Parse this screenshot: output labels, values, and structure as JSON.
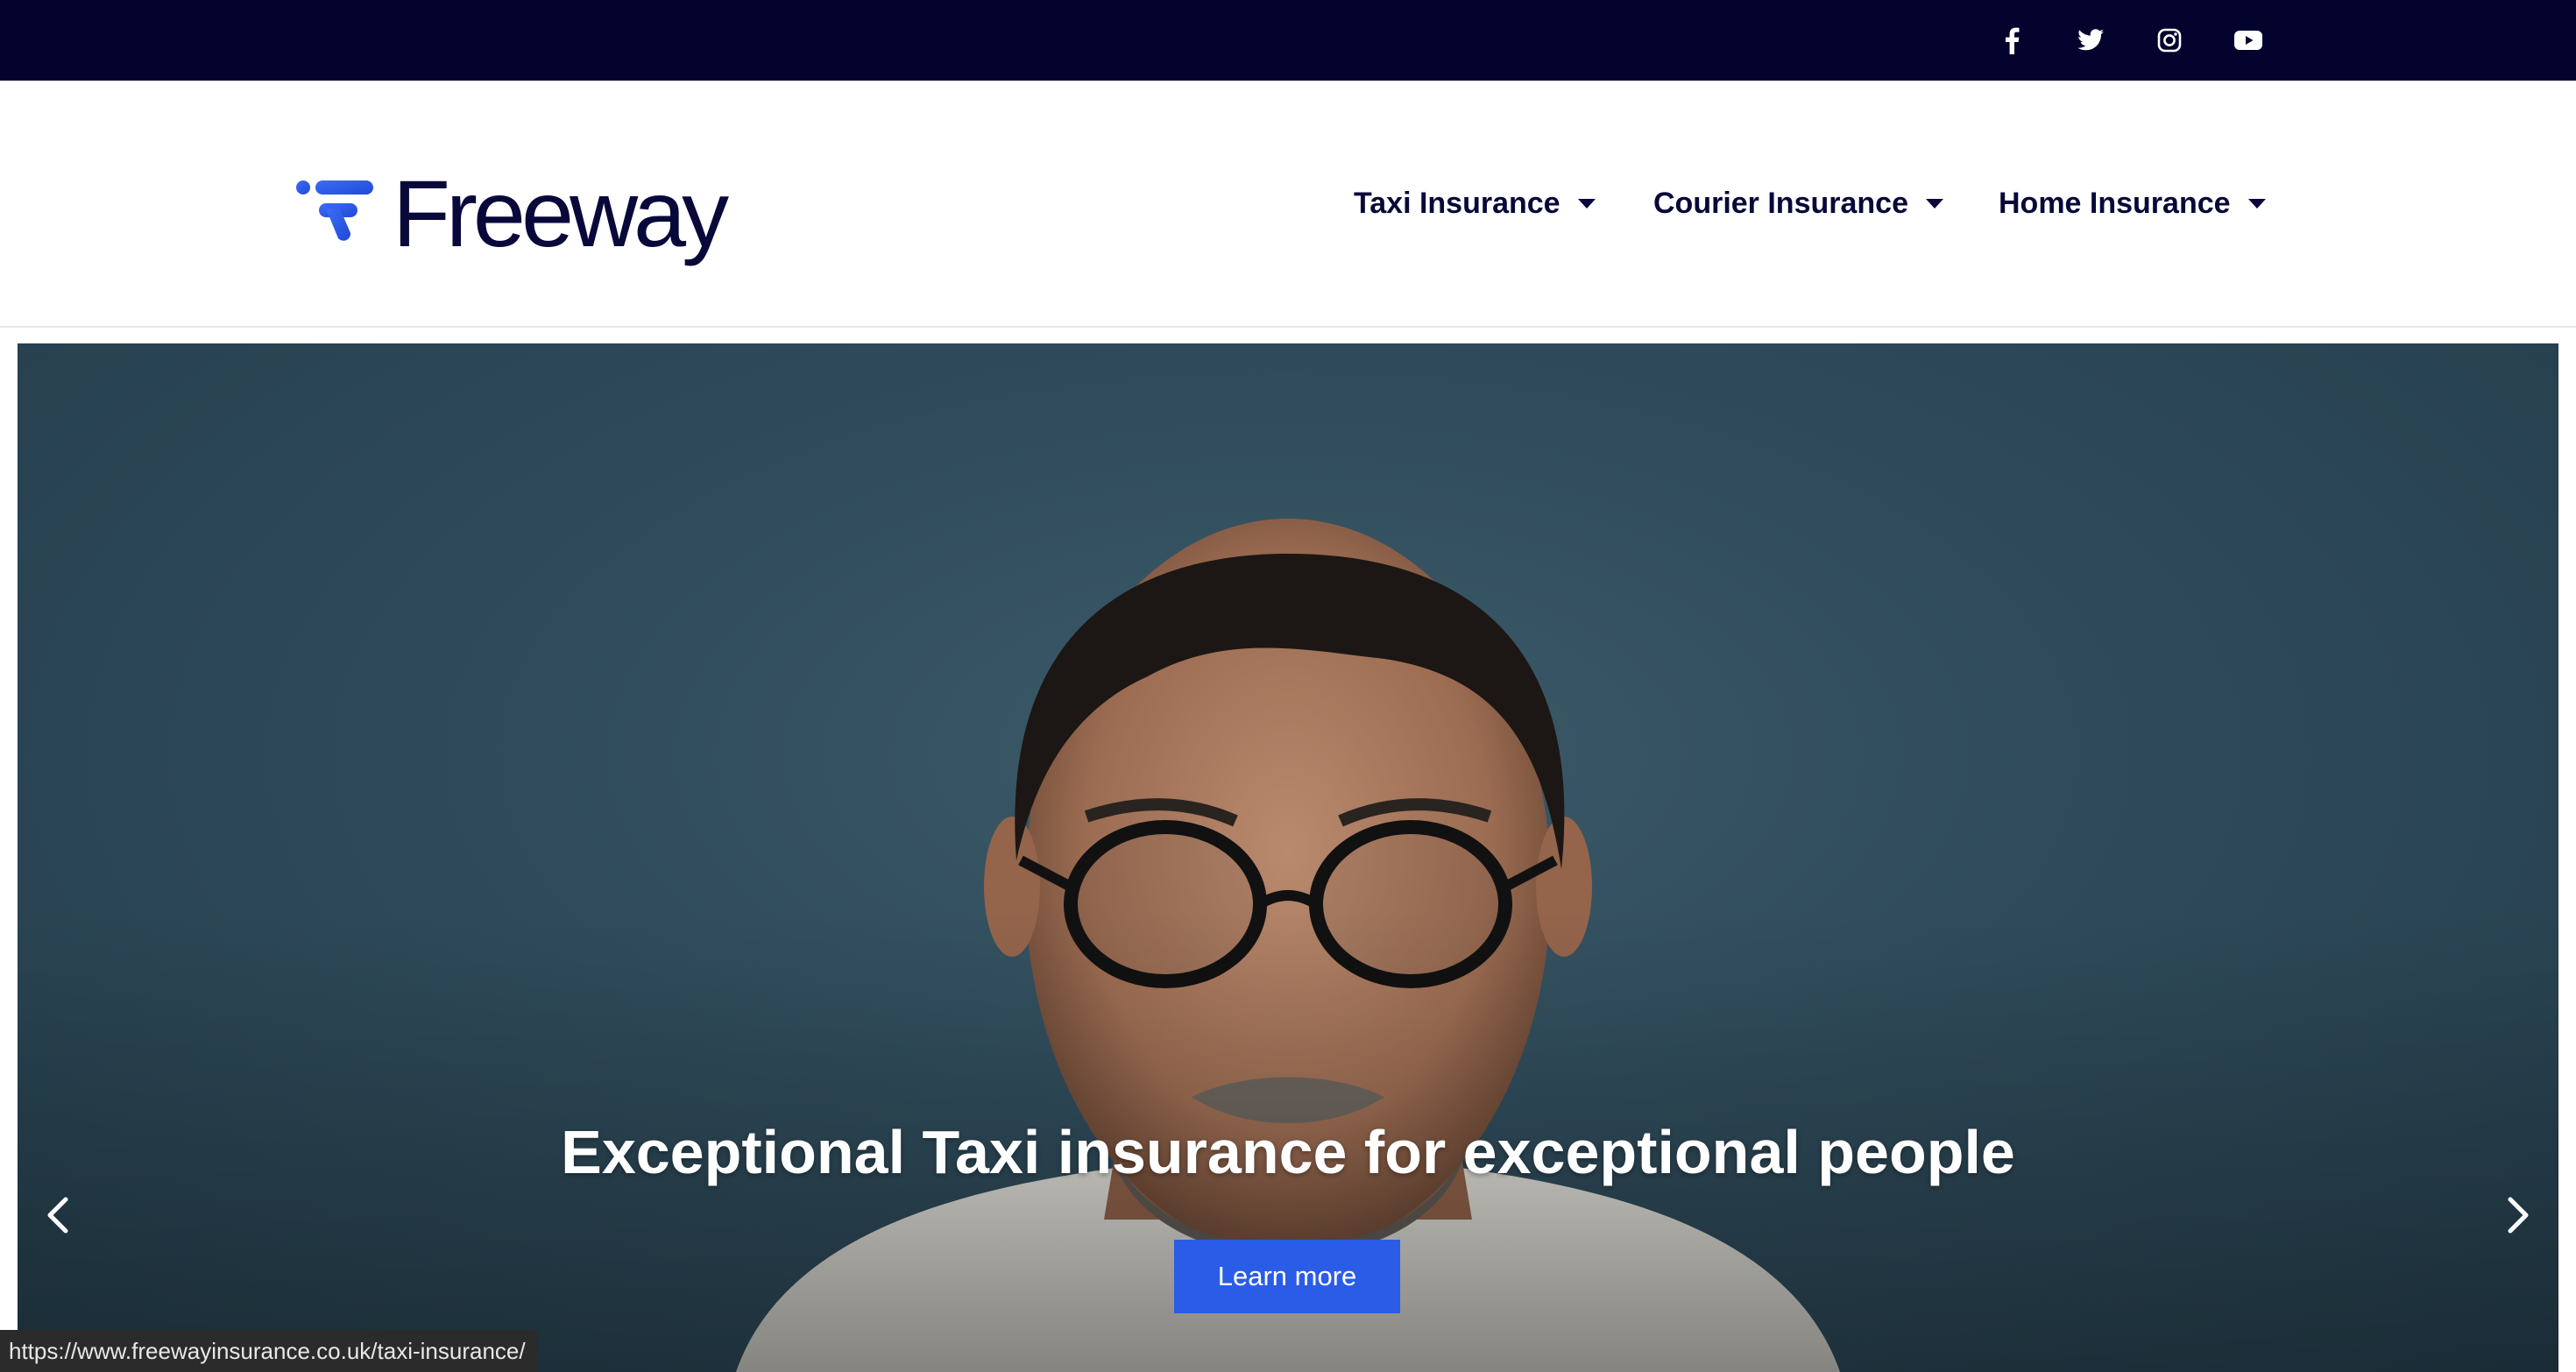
{
  "topbar": {
    "background": "#03032e",
    "social_icons": [
      "facebook-icon",
      "twitter-icon",
      "instagram-icon",
      "youtube-icon"
    ]
  },
  "header": {
    "logo_text": "Freeway",
    "brand_color": "#08083a",
    "logo_accent": "#2a5ce8",
    "nav": [
      {
        "label": "Taxi Insurance"
      },
      {
        "label": "Courier Insurance"
      },
      {
        "label": "Home Insurance"
      }
    ]
  },
  "hero": {
    "title": "Exceptional Taxi insurance for exceptional people",
    "button_label": "Learn more",
    "button_color": "#2a5ce8",
    "prev_icon": "chevron-left-icon",
    "next_icon": "chevron-right-icon"
  },
  "status_bar": {
    "url": "https://www.freewayinsurance.co.uk/taxi-insurance/"
  }
}
